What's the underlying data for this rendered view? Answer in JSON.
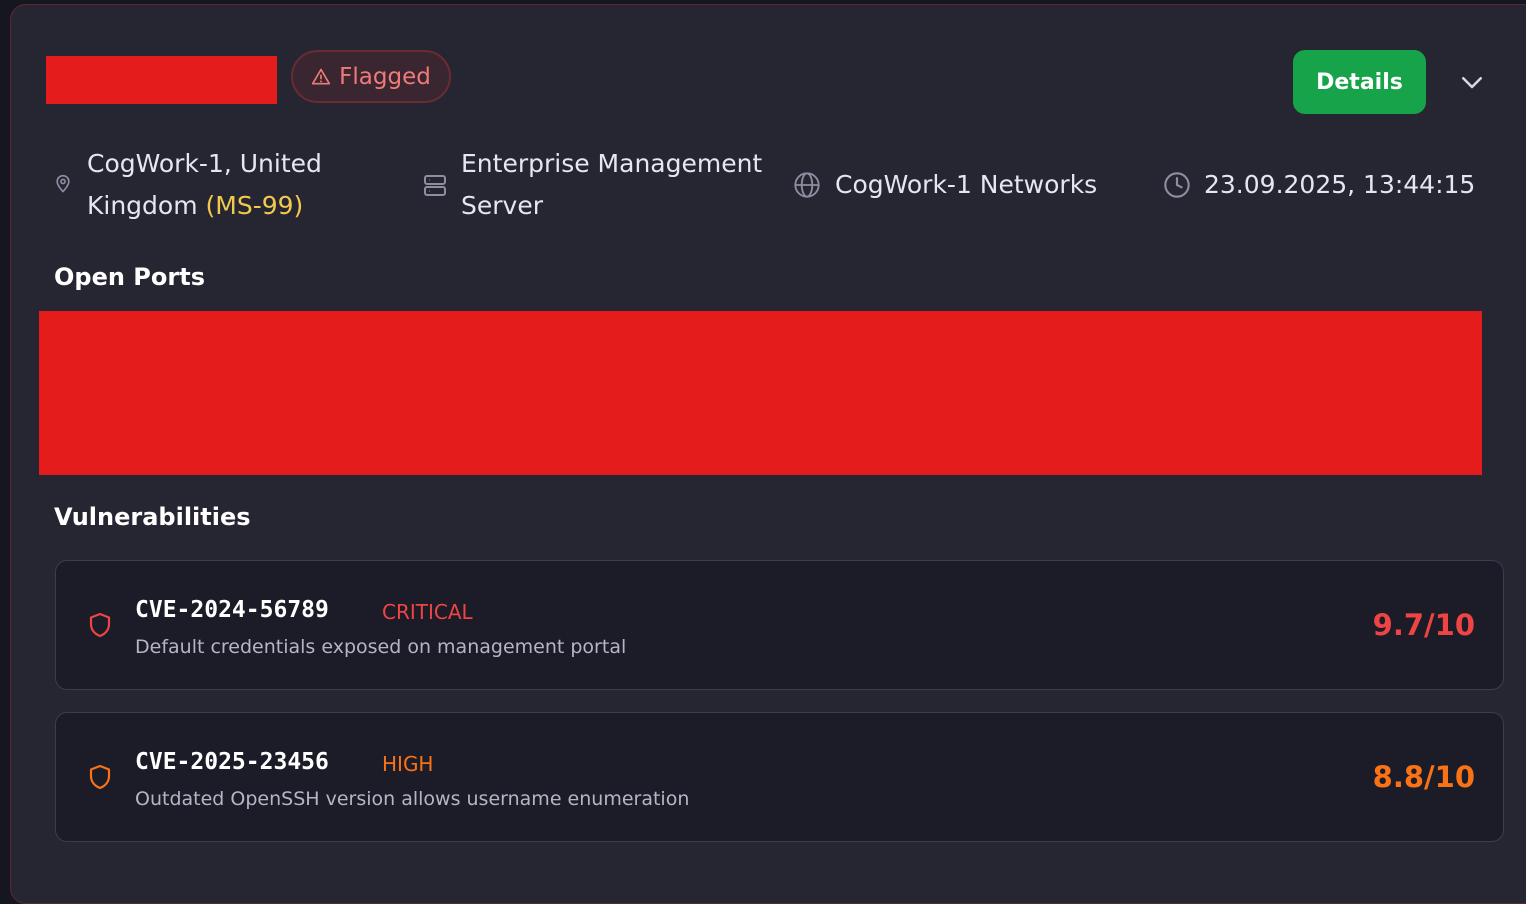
{
  "header": {
    "badge_label": "Flagged",
    "details_label": "Details"
  },
  "meta": {
    "location_line1": "CogWork-1, United",
    "location_line2": "Kingdom",
    "location_code": "(MS-99)",
    "server_line1": "Enterprise Management",
    "server_line2": "Server",
    "network": "CogWork-1 Networks",
    "timestamp": "23.09.2025, 13:44:15"
  },
  "sections": {
    "open_ports_title": "Open Ports",
    "vulnerabilities_title": "Vulnerabilities"
  },
  "vulnerabilities": [
    {
      "id": "CVE-2024-56789",
      "severity": "CRITICAL",
      "description": "Default credentials exposed on management portal",
      "score": "9.7/10",
      "color": "#ef4444"
    },
    {
      "id": "CVE-2025-23456",
      "severity": "HIGH",
      "description": "Outdated OpenSSH version allows username enumeration",
      "score": "8.8/10",
      "color": "#f97316"
    }
  ],
  "colors": {
    "card_bg": "#262633",
    "accent_green": "#17a34a",
    "code_yellow": "#f2c94c",
    "flag_red": "#f07a7a"
  },
  "icons": [
    "alert-triangle-icon",
    "chevron-down-icon",
    "map-pin-icon",
    "server-icon",
    "globe-icon",
    "clock-icon",
    "shield-icon"
  ]
}
